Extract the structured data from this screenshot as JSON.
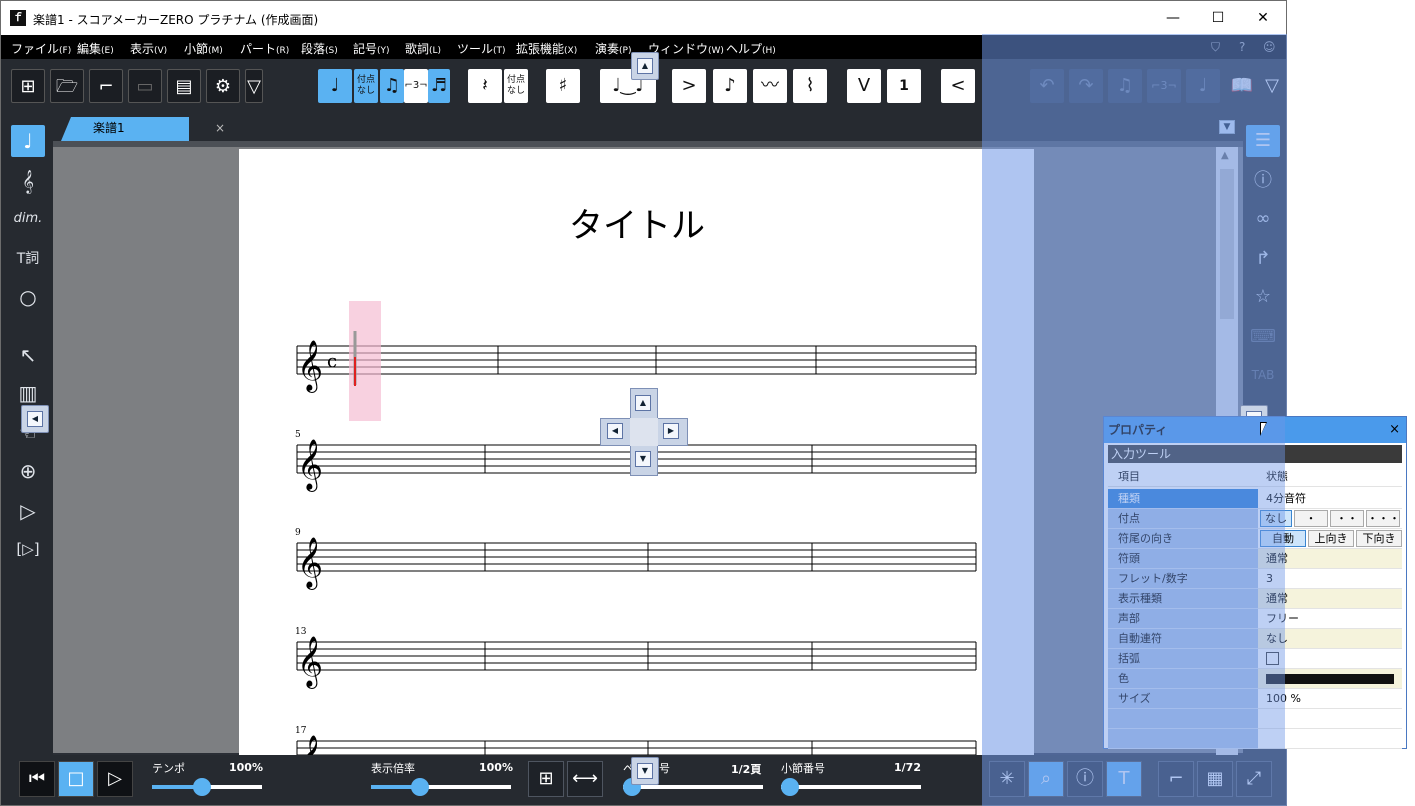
{
  "window": {
    "title": "楽譜1 - スコアメーカーZERO プラチナム (作成画面)",
    "logo": "ｆ",
    "controls": [
      "—",
      "☐",
      "✕"
    ]
  },
  "menu": [
    {
      "label": "ファイル",
      "key": "(F)"
    },
    {
      "label": "編集",
      "key": "(E)"
    },
    {
      "label": "表示",
      "key": "(V)"
    },
    {
      "label": "小節",
      "key": "(M)"
    },
    {
      "label": "パート",
      "key": "(R)"
    },
    {
      "label": "段落",
      "key": "(S)"
    },
    {
      "label": "記号",
      "key": "(Y)"
    },
    {
      "label": "歌詞",
      "key": "(L)"
    },
    {
      "label": "ツール",
      "key": "(T)"
    },
    {
      "label": "拡張機能",
      "key": "(X)"
    },
    {
      "label": "演奏",
      "key": "(P)"
    },
    {
      "label": "ウィンドウ",
      "key": "(W)"
    },
    {
      "label": "ヘルプ",
      "key": "(H)"
    }
  ],
  "toolbar": {
    "dot_none": "付点なし",
    "rest_dot_none": "付点なし",
    "sharp": "♯",
    "accent": ">",
    "upbow": "V",
    "fingering": "1",
    "triplet": "⌐3¬"
  },
  "tab": {
    "label": "楽譜1",
    "close": "×"
  },
  "score": {
    "title": "タイトル",
    "systems": [
      {
        "number": ""
      },
      {
        "number": "5"
      },
      {
        "number": "9"
      },
      {
        "number": "13"
      },
      {
        "number": "17"
      }
    ]
  },
  "properties": {
    "header": "プロパティ",
    "close": "×",
    "section": "入力ツール",
    "col_item": "項目",
    "col_state": "状態",
    "rows": [
      {
        "key": "種類",
        "value": "4分音符"
      },
      {
        "key": "付点",
        "value": ""
      },
      {
        "key": "符尾の向き",
        "value": ""
      },
      {
        "key": "符頭",
        "value": "通常"
      },
      {
        "key": "フレット/数字",
        "value": "3"
      },
      {
        "key": "表示種類",
        "value": "通常"
      },
      {
        "key": "声部",
        "value": "フリー"
      },
      {
        "key": "自動連符",
        "value": "なし"
      },
      {
        "key": "括弧",
        "value": ""
      },
      {
        "key": "色",
        "value": ""
      },
      {
        "key": "サイズ",
        "value": "100 %"
      }
    ],
    "dot_options": [
      "なし",
      "・",
      "・・",
      "・・・"
    ],
    "stem_options": [
      "自動",
      "上向き",
      "下向き"
    ],
    "color_value": "#111111"
  },
  "bottom": {
    "tempo_label": "テンポ",
    "tempo_value": "100%",
    "tempo_level": 0.45,
    "zoom_label": "表示倍率",
    "zoom_value": "100%",
    "zoom_level": 0.35,
    "page_label_left": "ペ",
    "page_label_right": "号",
    "page_value": "1/2頁",
    "measure_label": "小節番号",
    "measure_value": "1/72"
  },
  "colors": {
    "accent": "#5ab2f2",
    "dock_highlight": "#6e96e6",
    "cursor_red": "#e02020"
  }
}
